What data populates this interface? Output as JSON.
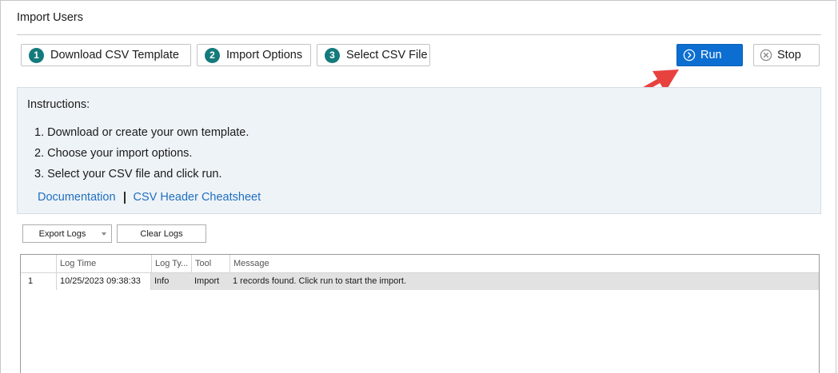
{
  "window": {
    "title": "Import Users"
  },
  "toolbar": {
    "steps": [
      {
        "number": "1",
        "label": "Download CSV Template"
      },
      {
        "number": "2",
        "label": "Import Options"
      },
      {
        "number": "3",
        "label": "Select CSV File"
      }
    ],
    "run_label": "Run",
    "stop_label": "Stop"
  },
  "instructions": {
    "title": "Instructions:",
    "steps": [
      "1. Download or create your own template.",
      "2. Choose your import options.",
      "3. Select your CSV file and click run."
    ],
    "links": {
      "documentation": "Documentation",
      "cheatsheet": "CSV Header Cheatsheet"
    }
  },
  "logs": {
    "export_label": "Export Logs",
    "clear_label": "Clear Logs",
    "columns": [
      "Log Time",
      "Log Ty...",
      "Tool",
      "Message"
    ],
    "rows": [
      {
        "index": "1",
        "log_time": "10/25/2023 09:38:33",
        "log_type": "Info",
        "tool": "Import",
        "message": "1 records found. Click run to start the import."
      }
    ]
  },
  "colors": {
    "accent": "#0c6ed1",
    "step_badge": "#157a7c",
    "link": "#1f6fbf",
    "instructions_bg": "#eef3f8",
    "annotation_arrow": "#e8423f"
  },
  "icons": {
    "run": "circle-chevron-right-icon",
    "stop": "circle-x-icon",
    "export_dropdown": "caret-down-icon",
    "annotation": "red-arrow-icon"
  }
}
